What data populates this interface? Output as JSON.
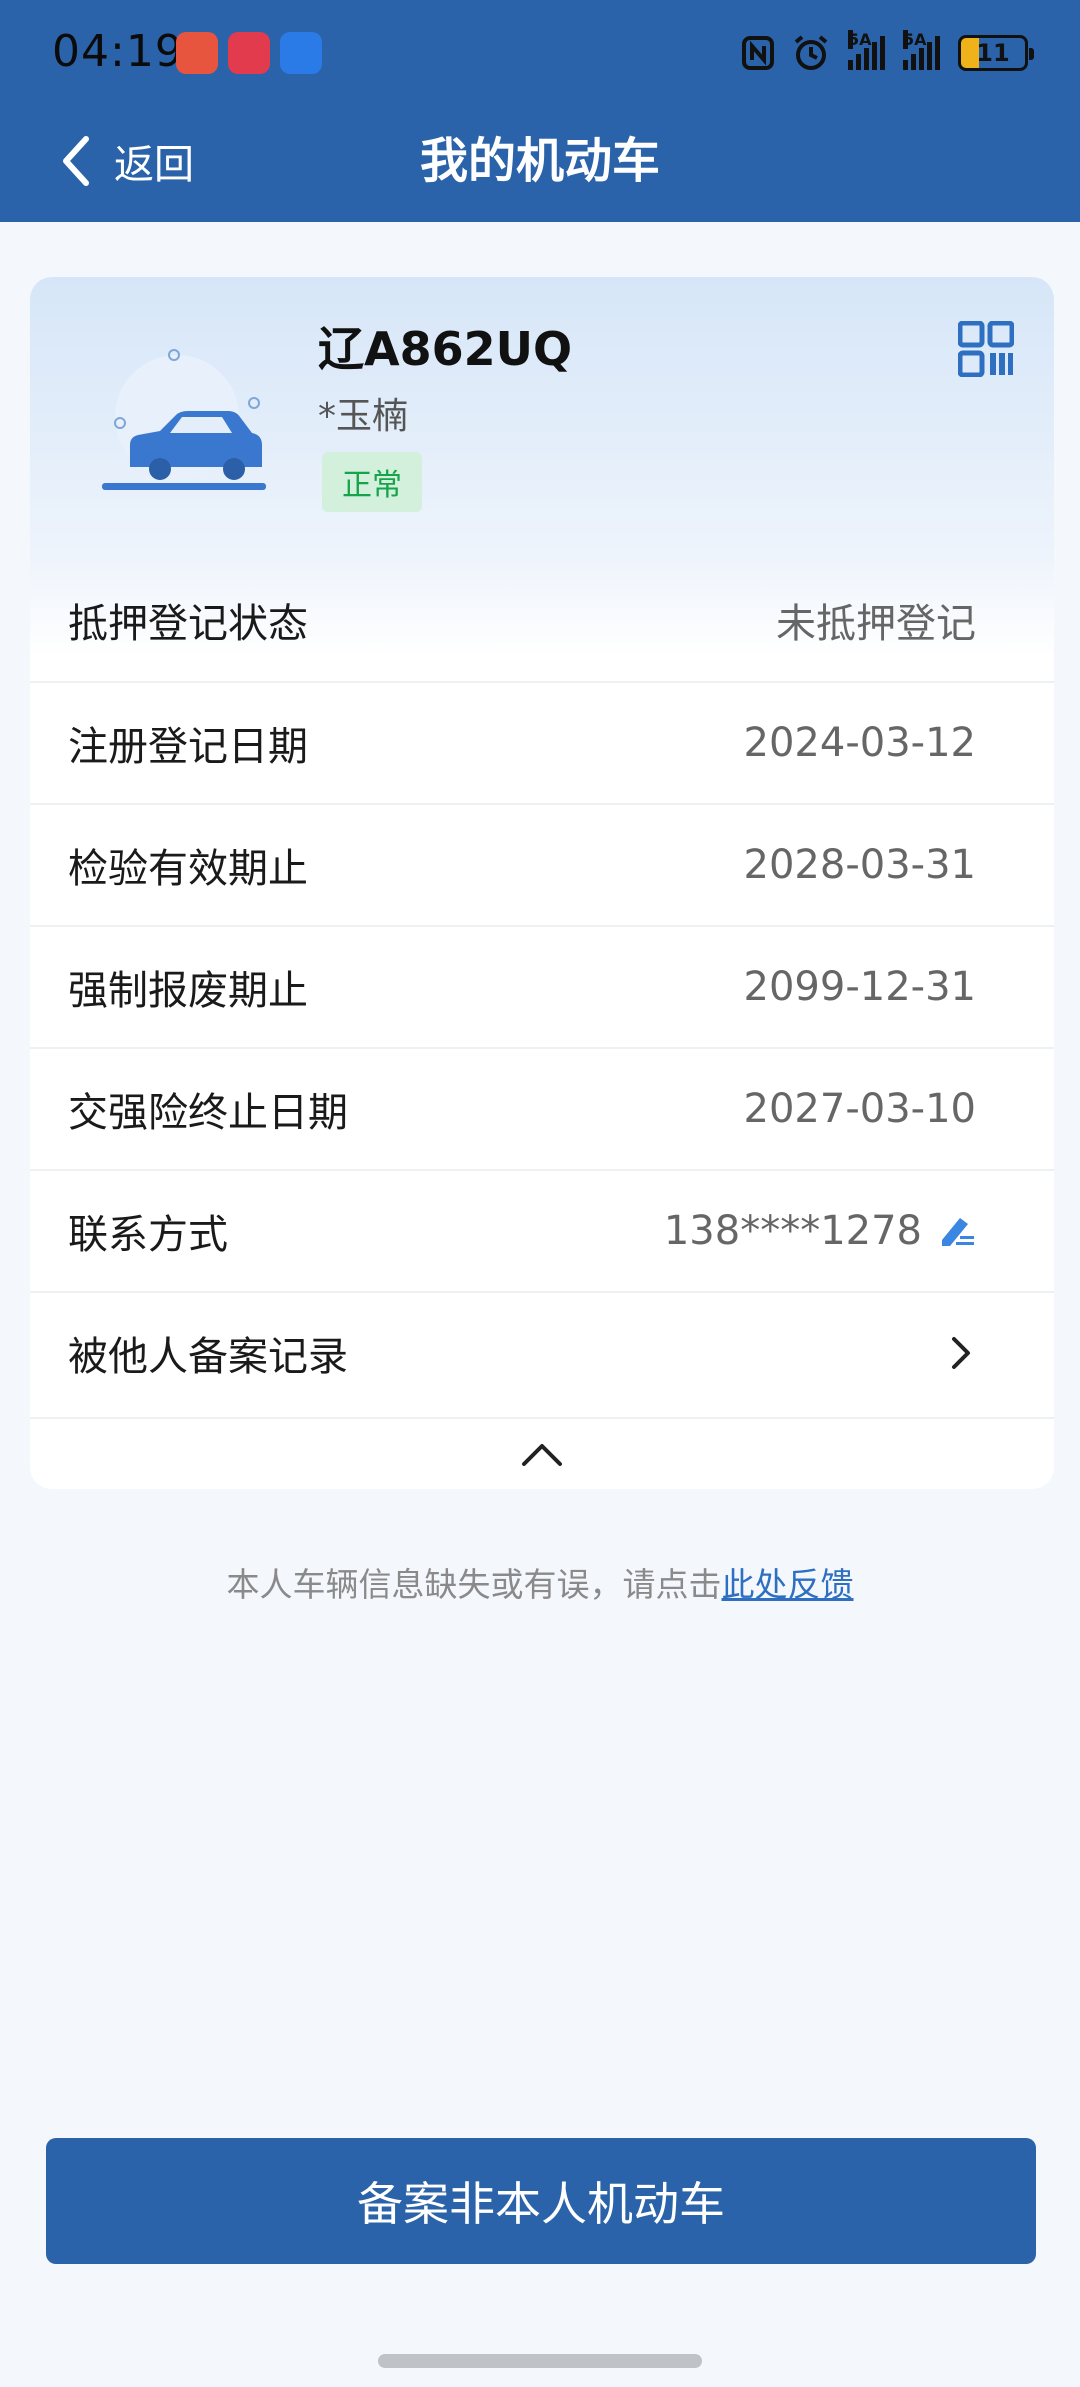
{
  "status_bar": {
    "time": "04:19",
    "battery": "11",
    "signal_1_label": "5A",
    "signal_2_label": "5A"
  },
  "header": {
    "back_label": "返回",
    "title": "我的机动车"
  },
  "vehicle": {
    "plate": "辽A862UQ",
    "owner": "*玉楠",
    "status": "正常"
  },
  "info_rows": [
    {
      "label": "抵押登记状态",
      "value": "未抵押登记"
    },
    {
      "label": "注册登记日期",
      "value": "2024-03-12"
    },
    {
      "label": "检验有效期止",
      "value": "2028-03-31"
    },
    {
      "label": "强制报废期止",
      "value": "2099-12-31"
    },
    {
      "label": "交强险终止日期",
      "value": "2027-03-10"
    },
    {
      "label": "联系方式",
      "value": "138****1278"
    },
    {
      "label": "被他人备案记录",
      "value": ""
    }
  ],
  "feedback": {
    "text": "本人车辆信息缺失或有误，请点击",
    "link": "此处反馈"
  },
  "primary_button": "备案非本人机动车",
  "colors": {
    "brand": "#2a63a9",
    "status_green": "#16a34a",
    "link": "#2e6fc1"
  }
}
